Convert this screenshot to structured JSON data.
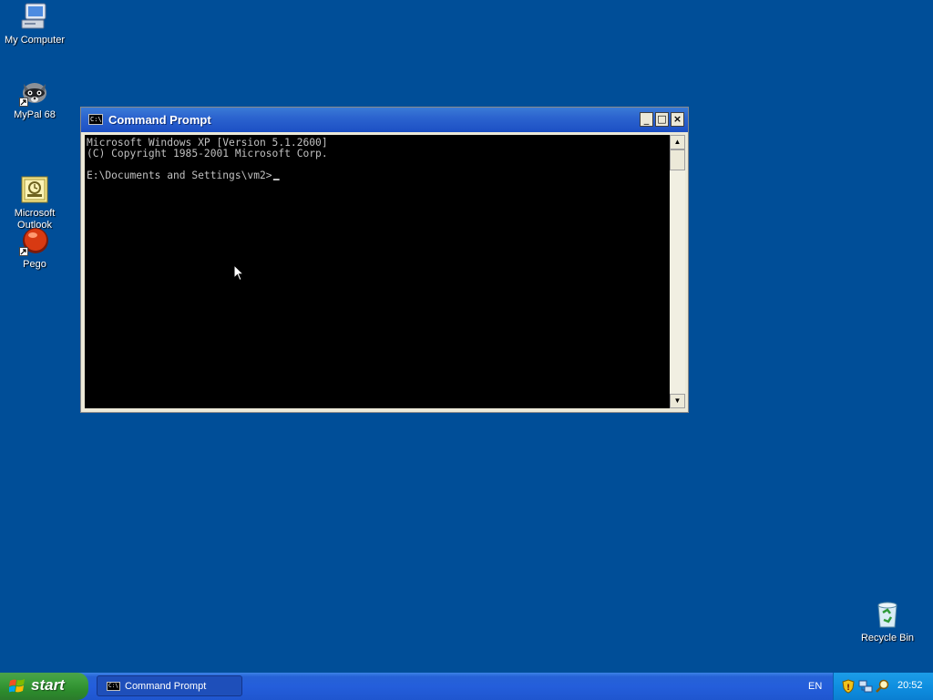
{
  "desktop": {
    "icons": [
      {
        "label": "My Computer"
      },
      {
        "label": "MyPal 68"
      },
      {
        "label": "Microsoft\nOutlook"
      },
      {
        "label": "Pego"
      },
      {
        "label": "Recycle Bin"
      }
    ]
  },
  "window": {
    "title": "Command Prompt",
    "icon_text": "C:\\",
    "buttons": {
      "minimize": "_",
      "maximize": "□",
      "close": "×"
    },
    "console_lines": [
      "Microsoft Windows XP [Version 5.1.2600]",
      "(C) Copyright 1985-2001 Microsoft Corp.",
      "",
      "E:\\Documents and Settings\\vm2>"
    ]
  },
  "taskbar": {
    "start_label": "start",
    "tasks": [
      {
        "label": "Command Prompt",
        "icon_text": "C:\\"
      }
    ],
    "language": "EN",
    "clock": "20:52"
  },
  "colors": {
    "desktop": "#004e98",
    "titlebar": "#2c64cf",
    "start": "#3c9e3c",
    "tray": "#0f8fe0"
  }
}
